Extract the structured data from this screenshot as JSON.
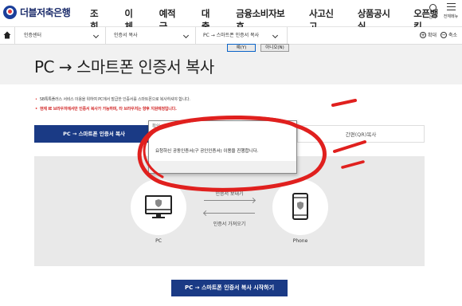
{
  "brand": {
    "name": "더블저축은행"
  },
  "nav": {
    "items": [
      "조회",
      "이체",
      "예적금",
      "대출",
      "금융소비자보호",
      "사고신고",
      "상품공시실",
      "오픈뱅킹"
    ],
    "search_label": "검색",
    "menu_label": "전체메뉴"
  },
  "breadcrumb": {
    "items": [
      "인증센터",
      "인증서 복사",
      "PC → 스마트폰 인증서 복사"
    ],
    "zoom_in": "확대",
    "zoom_out": "축소"
  },
  "page": {
    "title": "PC → 스마트폰 인증서 복사"
  },
  "notices": [
    "SB톡톡플러스 서비스 이용을 위하여 PC에서 발급한 인증서를 스마트폰으로 복사하셔야 합니다.",
    "현재 IE 브라우저에서만 인증서 복사가 가능하며, 타 브라우저는 향후 지원예정입니다."
  ],
  "tabs": {
    "active": "PC → 스마트폰 인증서 복사",
    "middle": "",
    "qr": "간편(QR)복사"
  },
  "diagram": {
    "pc_label": "PC",
    "phone_label": "Phone",
    "send_label": "인증서 보내기",
    "receive_label": "인증서 가져오기"
  },
  "start_button": "PC → 스마트폰 인증서 복사 시작하기",
  "dialog": {
    "title": "확인",
    "message": "요청하신 공동인증서(구 공인인증서) 이용을 진행합니다.",
    "yes": "예(Y)",
    "no": "아니오(N)"
  },
  "colors": {
    "primary": "#1a3a85",
    "annotation": "#e0201e",
    "notice_red": "#d32f2f",
    "panel": "#e9e9e9"
  }
}
